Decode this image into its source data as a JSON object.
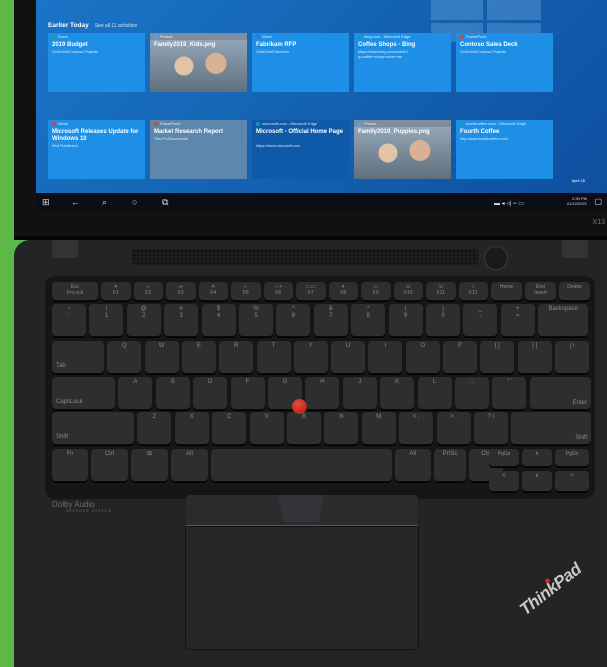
{
  "timeline": {
    "heading": "Earlier Today",
    "see_all": "See all 11 activities",
    "cards_row1": [
      {
        "app": "Excel",
        "title": "2019 Budget",
        "sub": "OneDrive/Contoso Projects",
        "kind": "doc",
        "color": "#1e8fe6",
        "app_color": "#21a366"
      },
      {
        "app": "Photos",
        "title": "Family2019_Kids.png",
        "sub": "",
        "kind": "img",
        "color": "#7c8ea0",
        "app_color": "#4aa3ff"
      },
      {
        "app": "Word",
        "title": "Fabrikam RFP",
        "sub": "OneDrive/Fabrikam",
        "kind": "doc",
        "color": "#1e8fe6",
        "app_color": "#2b7cd3"
      },
      {
        "app": "bing.com - Microsoft Edge",
        "title": "Coffee Shops - Bing",
        "sub": "https://www.bing.com/search?q=coffee+shops+near+me",
        "kind": "doc",
        "color": "#1e8fe6",
        "app_color": "#0fa3b1"
      },
      {
        "app": "PowerPoint",
        "title": "Contoso Sales Deck",
        "sub": "OneDrive/Contoso Projects",
        "kind": "doc",
        "color": "#1e8fe6",
        "app_color": "#d24726"
      }
    ],
    "cards_row2": [
      {
        "app": "News",
        "title": "Microsoft Releases Update for Windows 10",
        "sub": "Red Publishers",
        "kind": "doc",
        "color": "#1e8fe6",
        "app_color": "#e23b3b"
      },
      {
        "app": "PowerPoint",
        "title": "Market Research Report",
        "sub": "This PC/Documents",
        "kind": "doc",
        "color": "#5e87ad",
        "app_color": "#d24726"
      },
      {
        "app": "microsoft.com - Microsoft Edge",
        "title": "Microsoft - Official Home Page",
        "sub": "https://www.microsoft.com",
        "kind": "doc",
        "color": "#0e5aa8",
        "app_color": "#0fa3b1"
      },
      {
        "app": "Photos",
        "title": "Family2019_Puppies.png",
        "sub": "",
        "kind": "img",
        "color": "#7c8ea0",
        "app_color": "#4aa3ff"
      },
      {
        "app": "fourthcoffee.com - Microsoft Edge",
        "title": "Fourth Coffee",
        "sub": "http://www.fourthcoffee.com/",
        "kind": "doc",
        "color": "#1e8fe6",
        "app_color": "#0fa3b1"
      }
    ],
    "date_label": "April 26"
  },
  "taskbar": {
    "start": "⊞",
    "back": "←",
    "search": "⌕",
    "cortana": "○",
    "task_view": "⧉",
    "tray": "▬  ◂  ◃)  ⌁  ▭",
    "time": "2:30 PM",
    "date": "01/12/2021",
    "notification": "▢"
  },
  "lid_mark": "X13",
  "keyboard": {
    "fn_row": [
      {
        "top": "Esc",
        "bot": "FnLock"
      },
      {
        "top": "✕",
        "bot": "F1"
      },
      {
        "top": "◃-",
        "bot": "F2"
      },
      {
        "top": "◃+",
        "bot": "F3"
      },
      {
        "top": "✕",
        "bot": "F4"
      },
      {
        "top": "☼-",
        "bot": "F5"
      },
      {
        "top": "☼+",
        "bot": "F6"
      },
      {
        "top": "▭▭",
        "bot": "F7"
      },
      {
        "top": "✈",
        "bot": "F8"
      },
      {
        "top": "▭",
        "bot": "F9"
      },
      {
        "top": "☏",
        "bot": "F10"
      },
      {
        "top": "☏",
        "bot": "F11"
      },
      {
        "top": "☆",
        "bot": "F12"
      },
      {
        "top": "Home",
        "bot": ""
      },
      {
        "top": "End",
        "bot": "Insert"
      },
      {
        "top": "Delete",
        "bot": ""
      }
    ],
    "num_row": [
      {
        "top": "~",
        "bot": "`"
      },
      {
        "top": "!",
        "bot": "1"
      },
      {
        "top": "@",
        "bot": "2"
      },
      {
        "top": "#",
        "bot": "3"
      },
      {
        "top": "$",
        "bot": "4"
      },
      {
        "top": "%",
        "bot": "5"
      },
      {
        "top": "^",
        "bot": "6"
      },
      {
        "top": "&",
        "bot": "7"
      },
      {
        "top": "*",
        "bot": "8"
      },
      {
        "top": "(",
        "bot": "9"
      },
      {
        "top": ")",
        "bot": "0"
      },
      {
        "top": "_",
        "bot": "-"
      },
      {
        "top": "+",
        "bot": "="
      },
      {
        "top": "Backspace",
        "bot": ""
      }
    ],
    "top_row": [
      "Tab",
      "Q",
      "W",
      "E",
      "R",
      "T",
      "Y",
      "U",
      "I",
      "O",
      "P",
      "{ [",
      "} ]",
      "| \\"
    ],
    "home_row": [
      "CapsLock",
      "A",
      "S",
      "D",
      "F",
      "G",
      "H",
      "J",
      "K",
      "L",
      ": ;",
      "\" '",
      "Enter"
    ],
    "shift_row": [
      "Shift",
      "Z",
      "X",
      "C",
      "V",
      "B",
      "N",
      "M",
      "< ,",
      "> .",
      "? /",
      "Shift"
    ],
    "bottom_row": [
      "Fn",
      "Ctrl",
      "⊞",
      "Alt",
      "",
      "Alt",
      "PrtSc",
      "Ctrl"
    ],
    "nav": {
      "pgup": "PgUp",
      "pgdn": "PgDn",
      "up": "∧",
      "down": "∨",
      "left": "<",
      "right": ">"
    }
  },
  "branding": {
    "dolby": "Dolby Audio",
    "dolby_sub": "SPEAKER SYSTEM",
    "thinkpad": "ThinkPad"
  }
}
